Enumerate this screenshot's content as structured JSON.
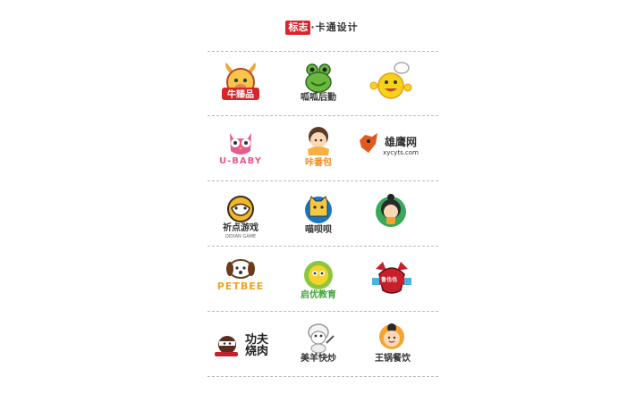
{
  "header": {
    "tag": "标志",
    "title": "·卡通设计"
  },
  "logos": [
    {
      "text": "牛臻品"
    },
    {
      "text": "呱呱后勤"
    },
    {
      "text": ""
    },
    {
      "text": "U-BABY"
    },
    {
      "text": "咔番包"
    },
    {
      "text": "雄鹰网",
      "subtext": "xycyts.com"
    },
    {
      "text": "祈点游戏",
      "subtext": "QIDIAN GAME"
    },
    {
      "text": "喵呗呗"
    },
    {
      "text": ""
    },
    {
      "text": "PETBEE"
    },
    {
      "text": "启优教育"
    },
    {
      "text": "鲁也也"
    },
    {
      "text": "功夫烧肉"
    },
    {
      "text": "美羊快炒"
    },
    {
      "text": "王锅餐饮"
    }
  ],
  "colors": {
    "accent": "#d9242b",
    "divider": "#b9b9b9"
  }
}
